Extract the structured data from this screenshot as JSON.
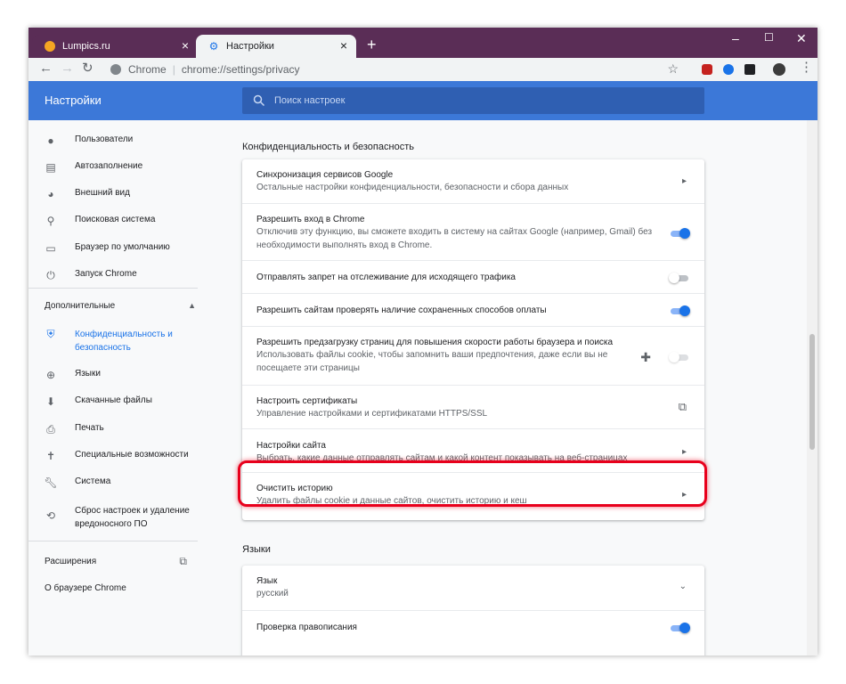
{
  "tabs": [
    {
      "label": "Lumpics.ru",
      "favicon_color": "#f5a623"
    },
    {
      "label": "Настройки",
      "favicon_color": "#1a73e8"
    }
  ],
  "window_controls": {
    "minimize": "–",
    "maximize": "☐",
    "close": "✕"
  },
  "omnibox": {
    "site_label": "Chrome",
    "url": "chrome://settings/privacy"
  },
  "header": {
    "title": "Настройки",
    "search_placeholder": "Поиск настроек"
  },
  "sidebar": {
    "items": [
      {
        "label": "Пользователи",
        "icon": "person-icon"
      },
      {
        "label": "Автозаполнение",
        "icon": "clipboard-icon"
      },
      {
        "label": "Внешний вид",
        "icon": "palette-icon"
      },
      {
        "label": "Поисковая система",
        "icon": "search-icon"
      },
      {
        "label": "Браузер по умолчанию",
        "icon": "browser-icon"
      },
      {
        "label": "Запуск Chrome",
        "icon": "power-icon"
      }
    ],
    "advanced_label": "Дополнительные",
    "advanced_items": [
      {
        "label": "Конфиденциальность и безопасность",
        "icon": "shield-icon",
        "selected": true
      },
      {
        "label": "Языки",
        "icon": "globe-icon"
      },
      {
        "label": "Скачанные файлы",
        "icon": "download-icon"
      },
      {
        "label": "Печать",
        "icon": "printer-icon"
      },
      {
        "label": "Специальные возможности",
        "icon": "accessibility-icon"
      },
      {
        "label": "Система",
        "icon": "wrench-icon"
      },
      {
        "label": "Сброс настроек и удаление вредоносного ПО",
        "icon": "restore-icon"
      }
    ],
    "extensions_label": "Расширения",
    "about_label": "О браузере Chrome"
  },
  "privacy": {
    "section_title": "Конфиденциальность и безопасность",
    "rows": [
      {
        "title": "Синхронизация сервисов Google",
        "desc": "Остальные настройки конфиденциальности, безопасности и сбора данных",
        "control": "arrow"
      },
      {
        "title": "Разрешить вход в Chrome",
        "desc": "Отключив эту функцию, вы сможете входить в систему на сайтах Google (например, Gmail) без необходимости выполнять вход в Chrome.",
        "control": "toggle-on"
      },
      {
        "title": "Отправлять запрет на отслеживание для исходящего трафика",
        "desc": "",
        "control": "toggle-off"
      },
      {
        "title": "Разрешить сайтам проверять наличие сохраненных способов оплаты",
        "desc": "",
        "control": "toggle-on"
      },
      {
        "title": "Разрешить предзагрузку страниц для повышения скорости работы браузера и поиска",
        "desc": "Использовать файлы cookie, чтобы запомнить ваши предпочтения, даже если вы не посещаете эти страницы",
        "control": "toggle-disabled"
      },
      {
        "title": "Настроить сертификаты",
        "desc": "Управление настройками и сертификатами HTTPS/SSL",
        "control": "external"
      },
      {
        "title": "Настройки сайта",
        "desc": "Выбрать, какие данные отправлять сайтам и какой контент показывать на веб-страницах",
        "control": "arrow"
      },
      {
        "title": "Очистить историю",
        "desc": "Удалить файлы cookie и данные сайтов, очистить историю и кеш",
        "control": "arrow"
      }
    ]
  },
  "languages": {
    "section_title": "Языки",
    "rows": [
      {
        "title": "Язык",
        "desc": "русский",
        "control": "chevron"
      },
      {
        "title": "Проверка правописания",
        "desc": "",
        "control": "toggle-on"
      }
    ]
  },
  "colors": {
    "accent": "#1a73e8",
    "header": "#3c78d8",
    "titlebar": "#5a2d56",
    "highlight": "#e8001c"
  }
}
